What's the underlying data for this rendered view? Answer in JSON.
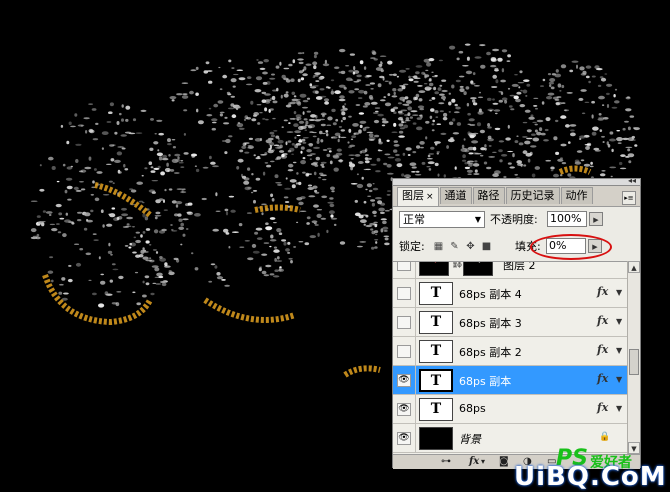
{
  "tabs": [
    {
      "label": "图层",
      "close": "×",
      "active": true
    },
    {
      "label": "通道",
      "active": false
    },
    {
      "label": "路径",
      "active": false
    },
    {
      "label": "历史记录",
      "active": false
    },
    {
      "label": "动作",
      "active": false
    }
  ],
  "options": {
    "blend_mode": "正常",
    "opacity_label": "不透明度:",
    "opacity_value": "100%",
    "lock_label": "锁定:",
    "fill_label": "填充:",
    "fill_value": "0%"
  },
  "layers": [
    {
      "name": "图层 2",
      "visible": false,
      "thumb": "image",
      "fx": false
    },
    {
      "name": "68ps 副本 4",
      "visible": false,
      "thumb": "T",
      "fx": true
    },
    {
      "name": "68ps 副本 3",
      "visible": false,
      "thumb": "T",
      "fx": true
    },
    {
      "name": "68ps 副本 2",
      "visible": false,
      "thumb": "T",
      "fx": true
    },
    {
      "name": "68ps 副本",
      "visible": true,
      "thumb": "T",
      "fx": true,
      "selected": true
    },
    {
      "name": "68ps",
      "visible": true,
      "thumb": "T",
      "fx": true
    },
    {
      "name": "背景",
      "visible": true,
      "thumb": "black",
      "fx": false,
      "locked": true
    }
  ],
  "fx_label": "fx",
  "layer_thumb_text": "68ps",
  "watermark": {
    "brand": "PS",
    "brand_suffix": "爱好者",
    "site": "UiBQ.CoM"
  },
  "colors": {
    "selected": "#3399ff",
    "annotation": "#d81010",
    "gold": "#e0a020",
    "watermark_green": "#19c019"
  }
}
